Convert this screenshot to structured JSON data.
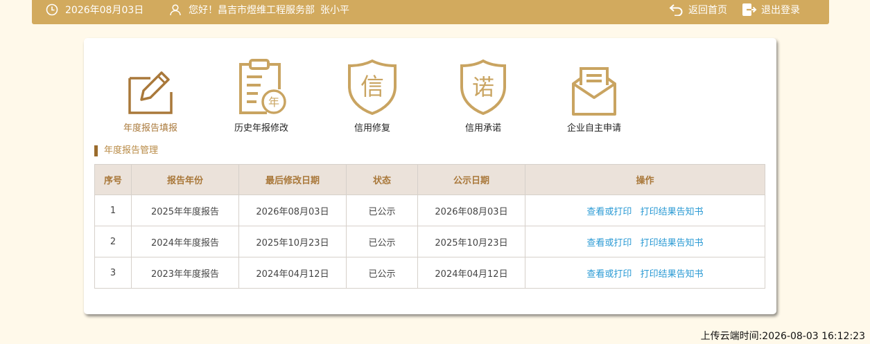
{
  "header": {
    "date": "2026年08月03日",
    "greeting": "您好！昌吉市煜维工程服务部",
    "user_name": "张小平",
    "home_label": "返回首页",
    "logout_label": "退出登录",
    "bg_color": "#d2aa5e"
  },
  "menu": {
    "items": [
      {
        "label": "年度报告填报",
        "icon": "edit-form-icon",
        "active": true
      },
      {
        "label": "历史年报修改",
        "icon": "clipboard-year-icon",
        "active": false
      },
      {
        "label": "信用修复",
        "icon": "shield-xin-icon",
        "active": false
      },
      {
        "label": "信用承诺",
        "icon": "shield-nuo-icon",
        "active": false
      },
      {
        "label": "企业自主申请",
        "icon": "envelope-icon",
        "active": false
      }
    ],
    "icon_color": "#c9a461",
    "active_color": "#a9783a"
  },
  "section": {
    "title": "年度报告管理"
  },
  "table": {
    "headers": [
      "序号",
      "报告年份",
      "最后修改日期",
      "状态",
      "公示日期",
      "操作"
    ],
    "rows": [
      {
        "no": "1",
        "year": "2025年年度报告",
        "modified": "2026年08月03日",
        "status": "已公示",
        "published": "2026年08月03日",
        "view": "查看或打印",
        "print": "打印结果告知书"
      },
      {
        "no": "2",
        "year": "2024年年度报告",
        "modified": "2025年10月23日",
        "status": "已公示",
        "published": "2025年10月23日",
        "view": "查看或打印",
        "print": "打印结果告知书"
      },
      {
        "no": "3",
        "year": "2023年年度报告",
        "modified": "2024年04月12日",
        "status": "已公示",
        "published": "2024年04月12日",
        "view": "查看或打印",
        "print": "打印结果告知书"
      }
    ]
  },
  "footer": {
    "upload_time": "上传云端时间:2026-08-03 16:12:23"
  }
}
